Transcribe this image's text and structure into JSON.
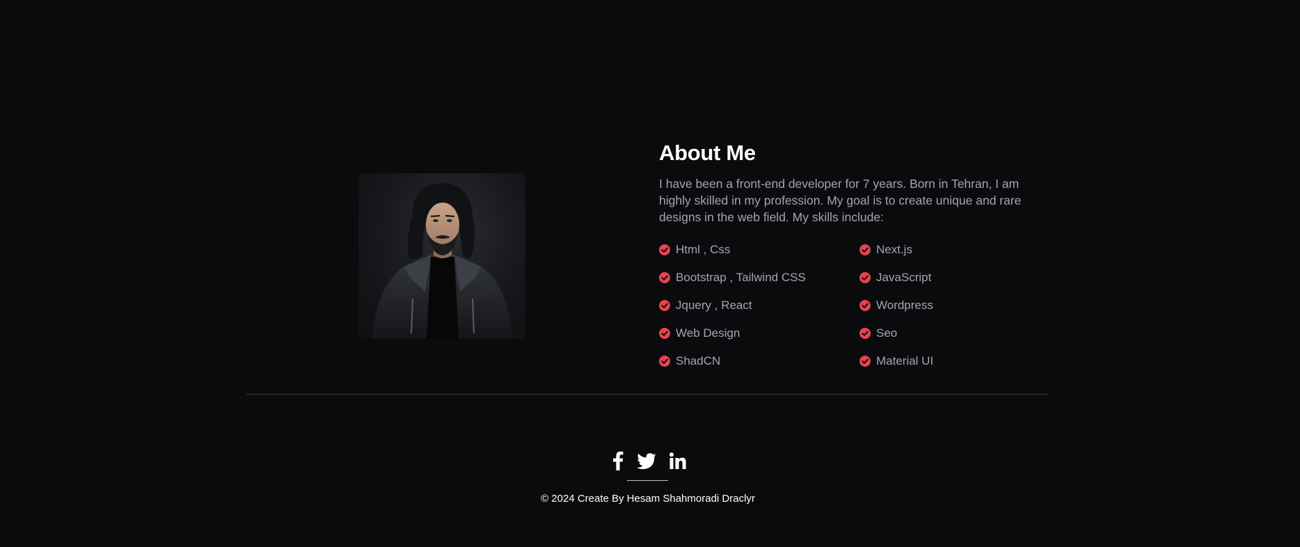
{
  "about": {
    "title": "About Me",
    "description": "I have been a front-end developer for 7 years. Born in Tehran, I am highly skilled in my profession. My goal is to create unique and rare designs in the web field. My skills include:",
    "portrait_icon": "profile-photo",
    "check_icon": "check-circle-icon",
    "check_color": "#e5444f",
    "skills": [
      "Html , Css",
      "Next.js",
      "Bootstrap , Tailwind CSS",
      "JavaScript",
      "Jquery , React",
      "Wordpress",
      "Web Design",
      "Seo",
      "ShadCN",
      "Material UI"
    ]
  },
  "footer": {
    "social_icons": [
      "facebook-icon",
      "twitter-icon",
      "linkedin-icon"
    ],
    "copyright": "© 2024 Create By Hesam Shahmoradi Draclyr"
  },
  "colors": {
    "background": "#0a0b0d",
    "heading": "#ffffff",
    "body_text": "#a2a6ae",
    "accent": "#e5444f"
  }
}
